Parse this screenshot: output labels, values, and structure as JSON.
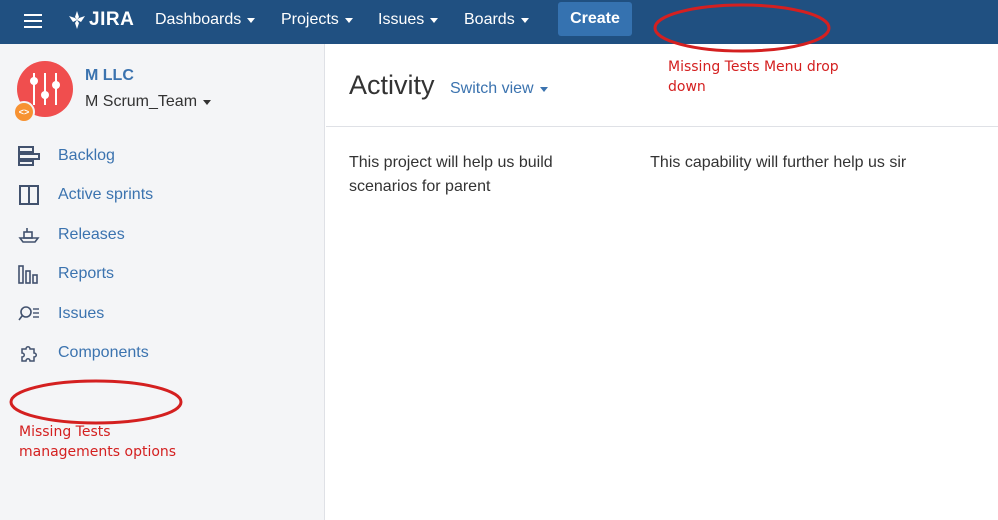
{
  "topnav": {
    "logo_text": "JIRA",
    "items": [
      {
        "label": "Dashboards"
      },
      {
        "label": "Projects"
      },
      {
        "label": "Issues"
      },
      {
        "label": "Boards"
      }
    ],
    "create_label": "Create",
    "colors": {
      "bar": "#205081",
      "create": "#3572b0"
    }
  },
  "sidebar": {
    "project_name": "M​​​ LLC",
    "board_name": "M Scrum_Team",
    "items": [
      {
        "label": "Backlog",
        "icon": "backlog-icon"
      },
      {
        "label": "Active sprints",
        "icon": "active-sprints-icon"
      },
      {
        "label": "Releases",
        "icon": "releases-icon"
      },
      {
        "label": "Reports",
        "icon": "reports-icon"
      },
      {
        "label": "Issues",
        "icon": "issues-icon"
      },
      {
        "label": "Components",
        "icon": "components-icon"
      }
    ]
  },
  "main": {
    "title": "Activity",
    "switch_view": "Switch view",
    "description_line1": "This project will help us build                      This capability will further help us sir",
    "description_line2": "scenarios for parent"
  },
  "annotations": {
    "top_note": "Missing Tests Menu drop\ndown",
    "side_note": "Missing Tests\nmanagements options",
    "color": "#d42020"
  }
}
